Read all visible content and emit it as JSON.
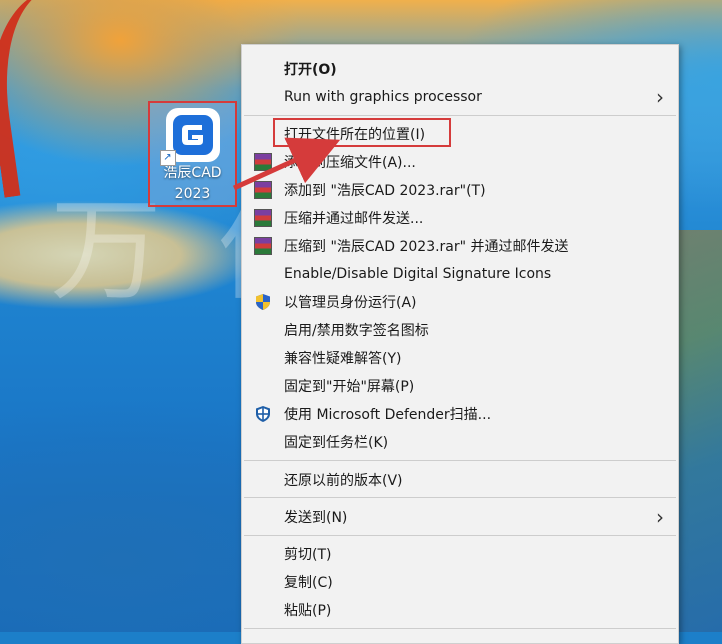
{
  "desktop": {
    "icon_label_line1": "浩辰CAD",
    "icon_label_line2": "2023",
    "watermark": "万 像 云 共 享"
  },
  "menu": {
    "items": [
      {
        "label": "打开(O)",
        "bold": true,
        "icon": ""
      },
      {
        "label": "Run with graphics processor",
        "submenu": true,
        "icon": ""
      },
      {
        "label": "打开文件所在的位置(I)",
        "icon": ""
      },
      {
        "label": "添加到压缩文件(A)...",
        "icon": "winrar-icon"
      },
      {
        "label": "添加到 \"浩辰CAD 2023.rar\"(T)",
        "icon": "winrar-icon"
      },
      {
        "label": "压缩并通过邮件发送...",
        "icon": "winrar-icon"
      },
      {
        "label": "压缩到 \"浩辰CAD 2023.rar\" 并通过邮件发送",
        "icon": "winrar-icon"
      },
      {
        "label": "Enable/Disable Digital Signature Icons",
        "icon": ""
      },
      {
        "label": "以管理员身份运行(A)",
        "icon": "uac-shield-icon"
      },
      {
        "label": "启用/禁用数字签名图标",
        "icon": ""
      },
      {
        "label": "兼容性疑难解答(Y)",
        "icon": ""
      },
      {
        "label": "固定到\"开始\"屏幕(P)",
        "icon": ""
      },
      {
        "label": "使用 Microsoft Defender扫描...",
        "icon": "defender-icon"
      },
      {
        "label": "固定到任务栏(K)",
        "icon": ""
      },
      {
        "label": "还原以前的版本(V)",
        "icon": ""
      },
      {
        "label": "发送到(N)",
        "submenu": true,
        "icon": ""
      },
      {
        "label": "剪切(T)",
        "icon": ""
      },
      {
        "label": "复制(C)",
        "icon": ""
      },
      {
        "label": "粘贴(P)",
        "icon": ""
      }
    ],
    "chevron": "›"
  },
  "colors": {
    "highlight_red": "#d53b3b",
    "menu_bg": "#f2f2f2",
    "app_brand_blue": "#1e6fd9"
  }
}
